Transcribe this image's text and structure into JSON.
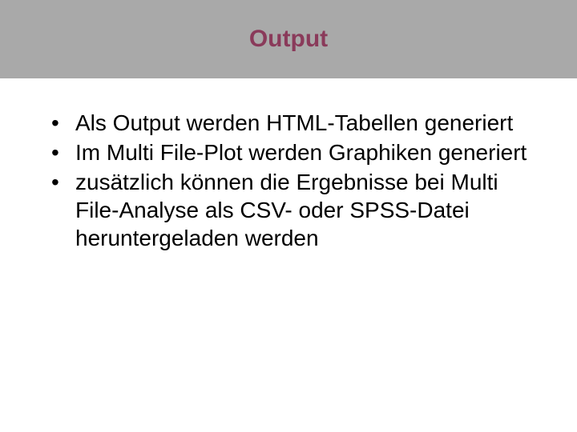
{
  "header": {
    "title": "Output"
  },
  "bullets": [
    "Als Output werden HTML-Tabellen generiert",
    "Im Multi File-Plot werden Graphiken generiert",
    "zusätzlich können die Ergebnisse bei Multi File-Analyse als CSV- oder SPSS-Datei heruntergeladen werden"
  ]
}
